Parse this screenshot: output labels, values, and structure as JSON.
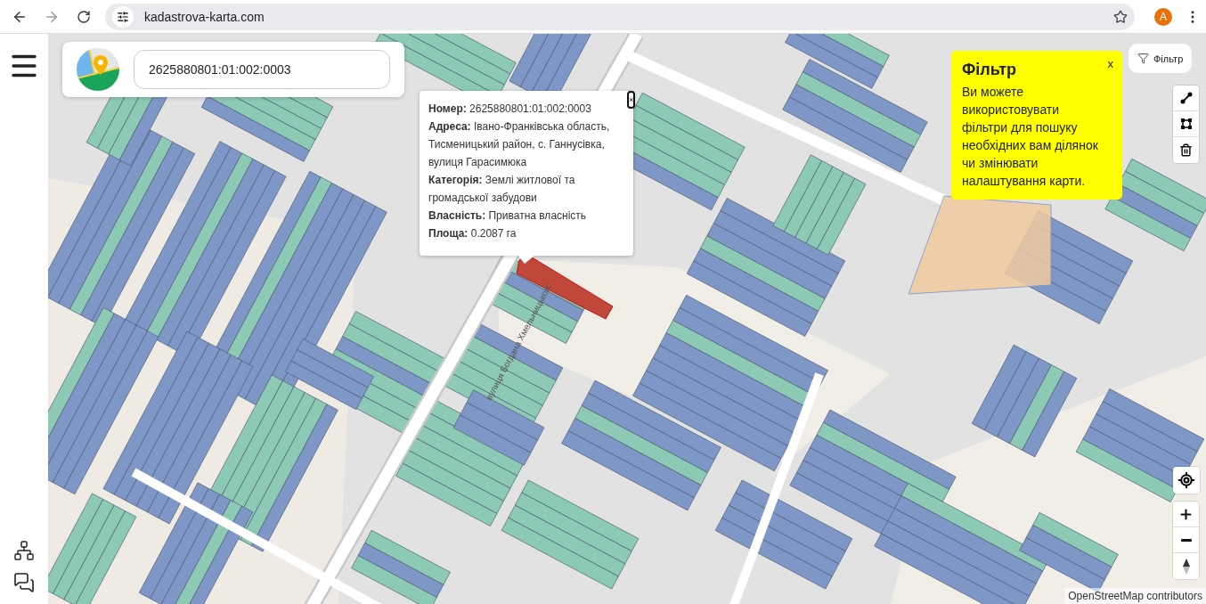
{
  "browser": {
    "url": "kadastrova-karta.com",
    "profile_initial": "A"
  },
  "search": {
    "value": "2625880801:01:002:0003"
  },
  "popup": {
    "close": "×",
    "lines": [
      "**Номер:** 2625880801:01:002:0003",
      "**Адреса:** Івано-Франківська область, Тисменицький район, с. Ганнусівка, вулиця Гарасимюка",
      "**Категорія:** Землі житлової та громадської забудови",
      "**Власність:** Приватна власність",
      "**Площа:** 0.2087 га"
    ]
  },
  "filter_tip": {
    "title": "Фільтр",
    "text": "Ви можете використовувати фільтри для пошуку необхідних вам ділянок чи змінювати налаштування карти.",
    "close": "x"
  },
  "filter_button": {
    "label": "Фільтр"
  },
  "map": {
    "street_labels": [
      "вулиця Богдана Хмельницького"
    ],
    "attribution": "OpenStreetMap contributors"
  }
}
